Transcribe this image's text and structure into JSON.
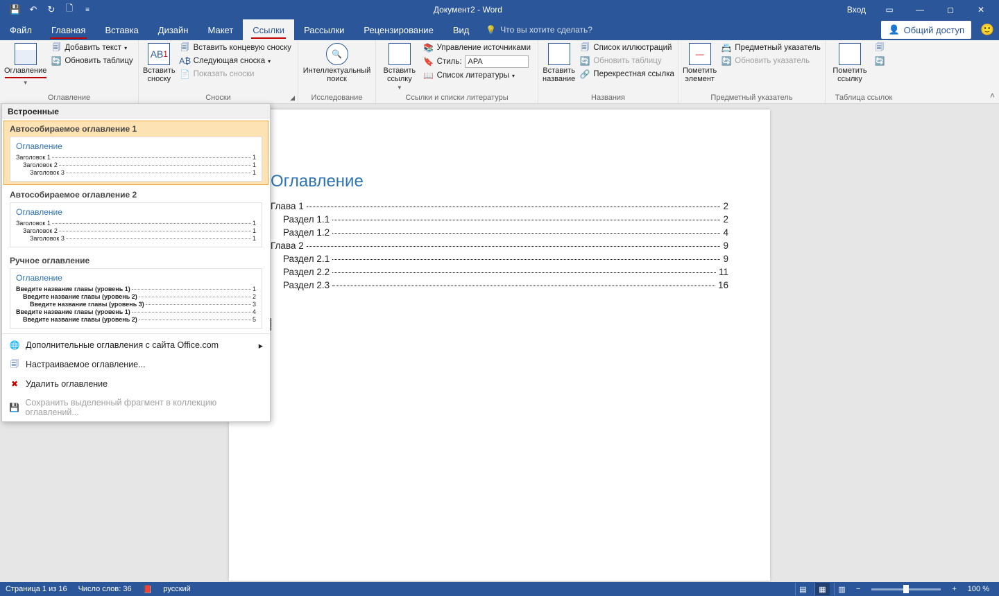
{
  "title": "Документ2  -  Word",
  "signin": "Вход",
  "tabs": {
    "file": "Файл",
    "home": "Главная",
    "insert": "Вставка",
    "design": "Дизайн",
    "layout": "Макет",
    "references": "Ссылки",
    "mailings": "Рассылки",
    "review": "Рецензирование",
    "view": "Вид"
  },
  "tell_me": "Что вы хотите сделать?",
  "share": "Общий доступ",
  "ribbon": {
    "toc_btn": "Оглавление",
    "add_text": "Добавить текст",
    "update_table": "Обновить таблицу",
    "group_toc": "Оглавление",
    "insert_footnote": "Вставить сноску",
    "insert_endnote": "Вставить концевую сноску",
    "next_footnote": "Следующая сноска",
    "show_notes": "Показать сноски",
    "group_footnotes": "Сноски",
    "smart_lookup": "Интеллектуальный поиск",
    "group_research": "Исследование",
    "insert_citation": "Вставить ссылку",
    "manage_sources": "Управление источниками",
    "style_label": "Стиль:",
    "style_value": "APA",
    "bibliography": "Список литературы",
    "group_citations": "Ссылки и списки литературы",
    "insert_caption": "Вставить название",
    "insert_tof": "Список иллюстраций",
    "update_tof": "Обновить таблицу",
    "cross_reference": "Перекрестная ссылка",
    "group_captions": "Названия",
    "mark_entry": "Пометить элемент",
    "insert_index": "Предметный указатель",
    "update_index": "Обновить указатель",
    "group_index": "Предметный указатель",
    "mark_citation": "Пометить ссылку",
    "insert_toa": "",
    "group_toa": "Таблица ссылок"
  },
  "dropdown": {
    "builtin": "Встроенные",
    "auto1": "Автособираемое оглавление 1",
    "auto2": "Автособираемое оглавление 2",
    "manual": "Ручное оглавление",
    "preview_title": "Оглавление",
    "p_h1": "Заголовок 1",
    "p_h2": "Заголовок 2",
    "p_h3": "Заголовок 3",
    "m_l1": "Введите название главы (уровень 1)",
    "m_l2": "Введите название главы (уровень 2)",
    "m_l3": "Введите название главы (уровень 3)",
    "m_l1b": "Введите название главы (уровень 1)",
    "m_l2b": "Введите название главы (уровень 2)",
    "mp1": "1",
    "mp2": "2",
    "mp3": "3",
    "mp4": "4",
    "mp5": "5",
    "more": "Дополнительные оглавления с сайта Office.com",
    "custom": "Настраиваемое оглавление...",
    "remove": "Удалить оглавление",
    "save_sel": "Сохранить выделенный фрагмент в коллекцию оглавлений..."
  },
  "document": {
    "heading": "Оглавление",
    "lines": [
      {
        "t": "Глава 1",
        "p": "2",
        "ind": 0
      },
      {
        "t": "Раздел 1.1",
        "p": "2",
        "ind": 1
      },
      {
        "t": "Раздел 1.2",
        "p": "4",
        "ind": 1
      },
      {
        "t": "Глава 2",
        "p": "9",
        "ind": 0
      },
      {
        "t": "Раздел 2.1",
        "p": "9",
        "ind": 1
      },
      {
        "t": "Раздел 2.2",
        "p": "11",
        "ind": 1
      },
      {
        "t": "Раздел 2.3",
        "p": "16",
        "ind": 1
      }
    ]
  },
  "status": {
    "page": "Страница 1 из 16",
    "words": "Число слов: 36",
    "lang": "русский",
    "zoom": "100 %"
  }
}
